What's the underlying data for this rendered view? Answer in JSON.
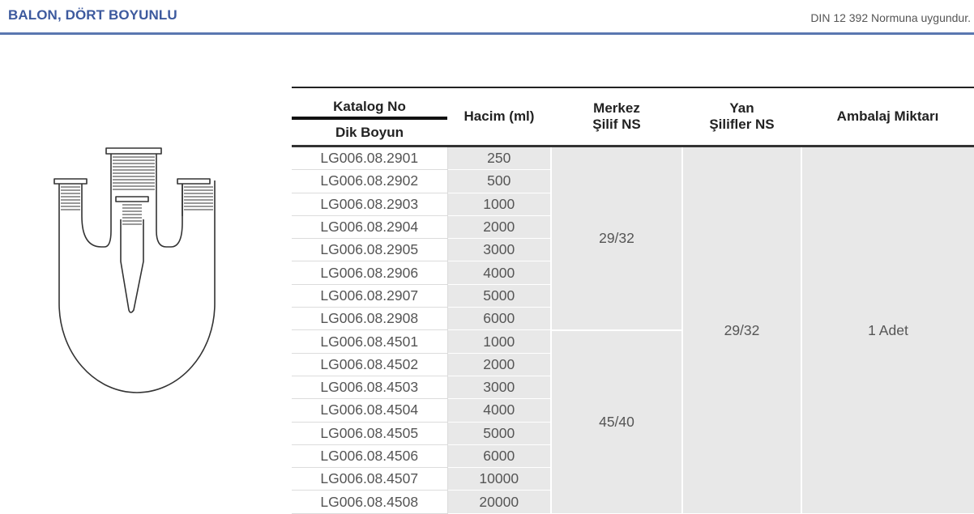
{
  "header": {
    "title": "BALON, DÖRT BOYUNLU",
    "norm": "DIN 12 392 Normuna uygundur."
  },
  "table": {
    "headers": {
      "katalog_no": "Katalog No",
      "dik_boyun": "Dik Boyun",
      "hacim": "Hacim (ml)",
      "merkez_line1": "Merkez",
      "merkez_line2": "Şilif NS",
      "yan_line1": "Yan",
      "yan_line2": "Şilifler NS",
      "ambalaj": "Ambalaj Miktarı"
    },
    "rows": [
      {
        "katalog": "LG006.08.2901",
        "hacim": "250"
      },
      {
        "katalog": "LG006.08.2902",
        "hacim": "500"
      },
      {
        "katalog": "LG006.08.2903",
        "hacim": "1000"
      },
      {
        "katalog": "LG006.08.2904",
        "hacim": "2000"
      },
      {
        "katalog": "LG006.08.2905",
        "hacim": "3000"
      },
      {
        "katalog": "LG006.08.2906",
        "hacim": "4000"
      },
      {
        "katalog": "LG006.08.2907",
        "hacim": "5000"
      },
      {
        "katalog": "LG006.08.2908",
        "hacim": "6000"
      },
      {
        "katalog": "LG006.08.4501",
        "hacim": "1000"
      },
      {
        "katalog": "LG006.08.4502",
        "hacim": "2000"
      },
      {
        "katalog": "LG006.08.4503",
        "hacim": "3000"
      },
      {
        "katalog": "LG006.08.4504",
        "hacim": "4000"
      },
      {
        "katalog": "LG006.08.4505",
        "hacim": "5000"
      },
      {
        "katalog": "LG006.08.4506",
        "hacim": "6000"
      },
      {
        "katalog": "LG006.08.4507",
        "hacim": "10000"
      },
      {
        "katalog": "LG006.08.4508",
        "hacim": "20000"
      }
    ],
    "merkez_groups": [
      "29/32",
      "45/40"
    ],
    "yan_value": "29/32",
    "ambalaj_value": "1 Adet"
  },
  "illustration": {
    "icon": "four-neck-flask-drawing"
  }
}
